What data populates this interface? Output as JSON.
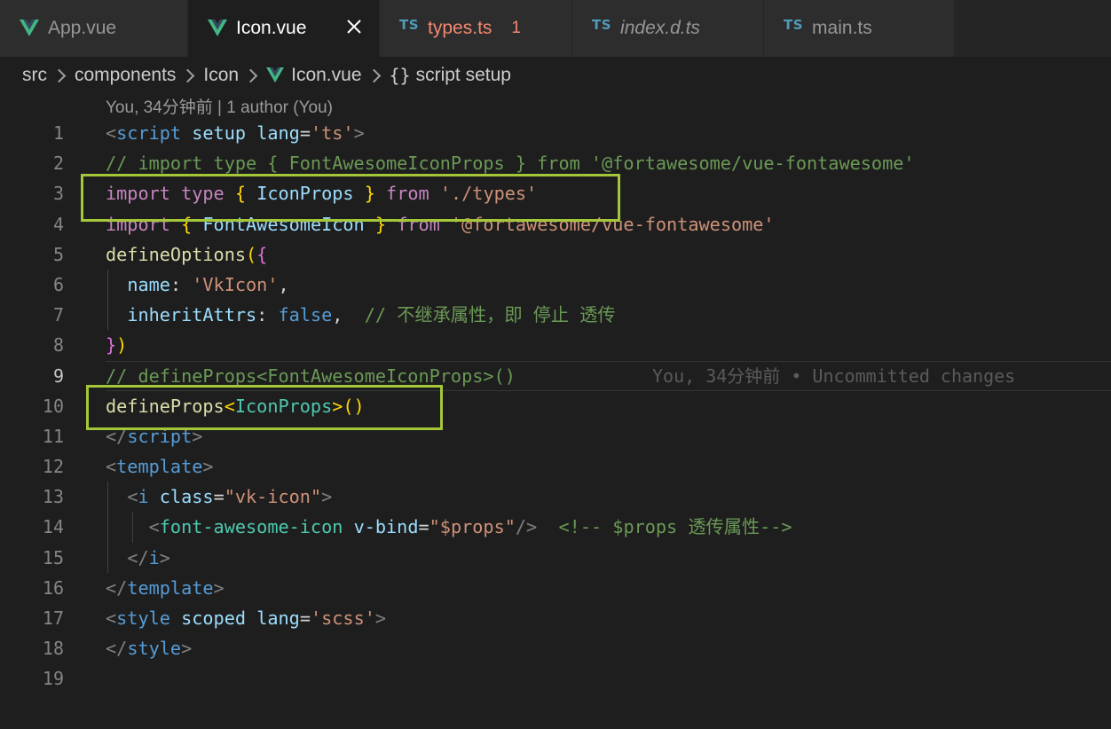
{
  "tabs": [
    {
      "label": "App.vue",
      "icon": "vue-icon",
      "active": false
    },
    {
      "label": "Icon.vue",
      "icon": "vue-icon",
      "active": true
    },
    {
      "label": "types.ts",
      "icon": "ts-icon",
      "badge": "TS",
      "problems": "1"
    },
    {
      "label": "index.d.ts",
      "icon": "ts-icon",
      "badge": "TS"
    },
    {
      "label": "main.ts",
      "icon": "ts-icon",
      "badge": "TS"
    }
  ],
  "breadcrumb": [
    "src",
    "components",
    "Icon",
    "Icon.vue",
    "script setup"
  ],
  "codelens": "You, 34分钟前 | 1 author (You)",
  "blame": "You, 34分钟前 • Uncommitted changes",
  "line_numbers": [
    "1",
    "2",
    "3",
    "4",
    "5",
    "6",
    "7",
    "8",
    "9",
    "10",
    "11",
    "12",
    "13",
    "14",
    "15",
    "16",
    "17",
    "18",
    "19"
  ],
  "code": {
    "l1": [
      "<",
      "script",
      "setup",
      "lang",
      "=",
      "'ts'",
      ">"
    ],
    "l2": "// import type { FontAwesomeIconProps } from '@fortawesome/vue-fontawesome'",
    "l3": [
      "import",
      "type",
      "{",
      "IconProps",
      "}",
      "from",
      "'./types'"
    ],
    "l4": [
      "import",
      "{",
      "FontAwesomeIcon",
      "}",
      "from",
      "'@fortawesome/vue-fontawesome'"
    ],
    "l5": [
      "defineOptions",
      "(",
      "{"
    ],
    "l6": [
      "name",
      ":",
      "'VkIcon'",
      ","
    ],
    "l7": [
      "inheritAttrs",
      ":",
      "false",
      ",",
      "// 不继承属性，即 停止 透传"
    ],
    "l8": [
      "}",
      ")"
    ],
    "l9": "// defineProps<FontAwesomeIconProps>()",
    "l10": [
      "defineProps",
      "<",
      "IconProps",
      ">",
      "()"
    ],
    "l11": [
      "</",
      "script",
      ">"
    ],
    "l12": [
      "<",
      "template",
      ">"
    ],
    "l13": [
      "<",
      "i",
      "class",
      "=",
      "\"vk-icon\"",
      ">"
    ],
    "l14": [
      "<",
      "font-awesome-icon",
      "v-bind",
      "=",
      "\"$props\"",
      "/>",
      "<!-- $props 透传属性-->"
    ],
    "l15": [
      "</",
      "i",
      ">"
    ],
    "l16": [
      "</",
      "template",
      ">"
    ],
    "l17": [
      "<",
      "style",
      "scoped",
      "lang",
      "=",
      "'scss'",
      ">"
    ],
    "l18": [
      "</",
      "style",
      ">"
    ]
  },
  "colors": {
    "highlight_box": "#a4c639",
    "vue": "#41b883",
    "ts": "#519aba"
  }
}
